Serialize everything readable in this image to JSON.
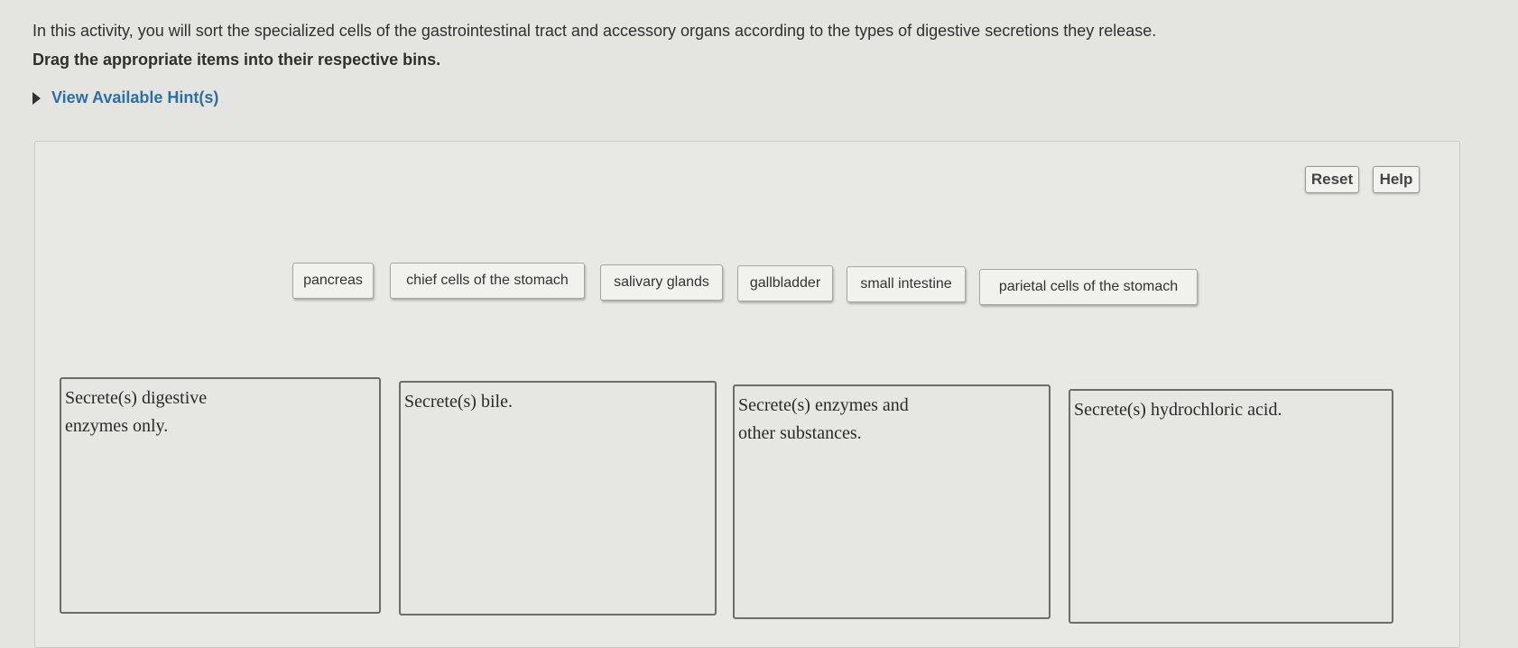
{
  "intro_text": "In this activity, you will sort the specialized cells of the gastrointestinal tract and accessory organs according to the types of digestive secretions they release.",
  "instruction": "Drag the appropriate items into their respective bins.",
  "hint_toggle": {
    "label": "View Available Hint(s)",
    "icon": "triangle-right-icon"
  },
  "toolbar": {
    "reset_label": "Reset",
    "help_label": "Help"
  },
  "items": [
    {
      "label": "pancreas"
    },
    {
      "label": "chief cells of the stomach"
    },
    {
      "label": "salivary glands"
    },
    {
      "label": "gallbladder"
    },
    {
      "label": "small intestine"
    },
    {
      "label": "parietal cells of the stomach"
    }
  ],
  "bins": [
    {
      "label_line1": "Secrete(s) digestive",
      "label_line2": "enzymes only."
    },
    {
      "label_line1": "Secrete(s) bile.",
      "label_line2": ""
    },
    {
      "label_line1": "Secrete(s) enzymes and",
      "label_line2": "other substances."
    },
    {
      "label_line1": "Secrete(s) hydrochloric acid.",
      "label_line2": ""
    }
  ]
}
